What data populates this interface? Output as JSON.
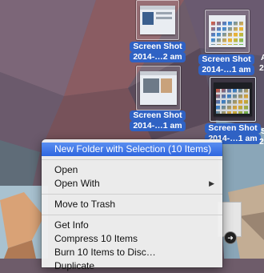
{
  "desktop": {
    "icons": [
      {
        "line1": "Screen Shot",
        "line2": "2014-…2 am",
        "style": "light"
      },
      {
        "line1": "Screen Shot",
        "line2": "2014-…1 am",
        "style": "light"
      },
      {
        "line1": "Screen Shot",
        "line2": "2014-…1 am",
        "style": "light"
      },
      {
        "line1": "Screen Shot",
        "line2": "2014-…1 am",
        "style": "dark"
      }
    ],
    "side_text_1": "A",
    "side_text_2": "2",
    "side_text_3": "S",
    "side_text_4": "2"
  },
  "context_menu": {
    "new_folder": "New Folder with Selection (10 Items)",
    "open": "Open",
    "open_with": "Open With",
    "move_to_trash": "Move to Trash",
    "get_info": "Get Info",
    "compress": "Compress 10 Items",
    "burn": "Burn 10 Items to Disc…",
    "duplicate": "Duplicate",
    "submenu_arrow_icon": "triangle-right-icon"
  },
  "colors": {
    "selection_label": "#2f62c4",
    "menu_highlight": "#2e66e0",
    "menu_background": "#f0f0f0"
  }
}
